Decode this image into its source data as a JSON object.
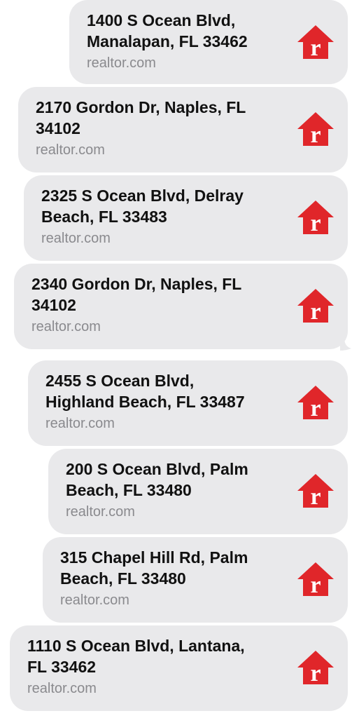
{
  "brand": {
    "logo_color": "#e0262a",
    "bubble_color": "#e9e9eb"
  },
  "messages": [
    {
      "address_line1": "1400 S Ocean Blvd,",
      "address_line2": "Manalapan, FL 33462",
      "domain": "realtor.com",
      "icon": "realtor-logo-icon"
    },
    {
      "address_line1": "2170 Gordon Dr, Naples, FL",
      "address_line2": "34102",
      "domain": "realtor.com",
      "icon": "realtor-logo-icon"
    },
    {
      "address_line1": "2325 S Ocean Blvd, Delray",
      "address_line2": "Beach, FL 33483",
      "domain": "realtor.com",
      "icon": "realtor-logo-icon"
    },
    {
      "address_line1": "2340 Gordon Dr, Naples, FL",
      "address_line2": "34102",
      "domain": "realtor.com",
      "icon": "realtor-logo-icon"
    },
    {
      "address_line1": "2455 S Ocean Blvd,",
      "address_line2": "Highland Beach, FL 33487",
      "domain": "realtor.com",
      "icon": "realtor-logo-icon"
    },
    {
      "address_line1": "200 S Ocean Blvd, Palm",
      "address_line2": "Beach, FL 33480",
      "domain": "realtor.com",
      "icon": "realtor-logo-icon"
    },
    {
      "address_line1": "315 Chapel Hill Rd, Palm",
      "address_line2": "Beach, FL 33480",
      "domain": "realtor.com",
      "icon": "realtor-logo-icon"
    },
    {
      "address_line1": "1110 S Ocean Blvd, Lantana,",
      "address_line2": "FL 33462",
      "domain": "realtor.com",
      "icon": "realtor-logo-icon"
    }
  ]
}
